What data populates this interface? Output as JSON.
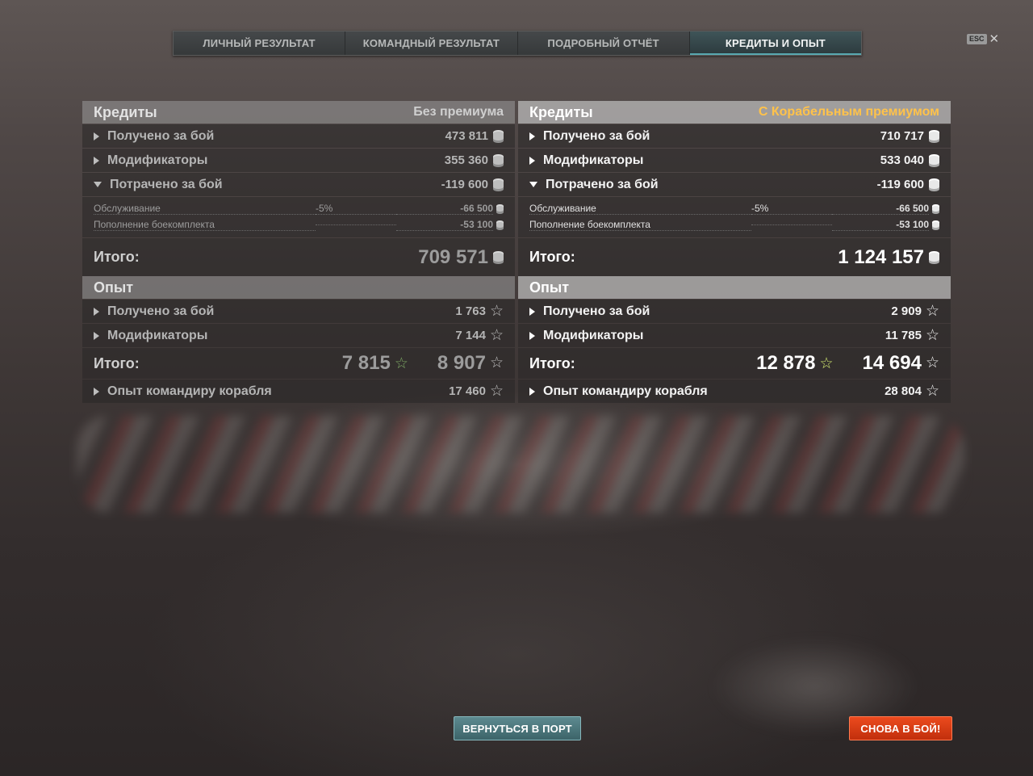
{
  "tabs": [
    {
      "label": "ЛИЧНЫЙ РЕЗУЛЬТАТ",
      "active": false
    },
    {
      "label": "КОМАНДНЫЙ РЕЗУЛЬТАТ",
      "active": false
    },
    {
      "label": "ПОДРОБНЫЙ ОТЧЁТ",
      "active": false
    },
    {
      "label": "КРЕДИТЫ И ОПЫТ",
      "active": true
    }
  ],
  "esc": {
    "key": "ESC",
    "close": "✕"
  },
  "colors": {
    "premium_accent": "#ffc24a",
    "xp_green": "#a8e86a",
    "battle_button": "#e0401a",
    "port_button": "#4d767b"
  },
  "left": {
    "credits": {
      "title": "Кредиты",
      "subtitle": "Без премиума",
      "earned": {
        "label": "Получено за бой",
        "value": "473 811"
      },
      "modifiers": {
        "label": "Модификаторы",
        "value": "355 360"
      },
      "spent": {
        "label": "Потрачено за бой",
        "value": "-119 600"
      },
      "service": {
        "label": "Обслуживание",
        "pct": "-5%",
        "value": "-66 500"
      },
      "ammo": {
        "label": "Пополнение боекомплекта",
        "value": "-53 100"
      },
      "total": {
        "label": "Итого:",
        "value": "709 571"
      }
    },
    "xp": {
      "title": "Опыт",
      "earned": {
        "label": "Получено за бой",
        "value": "1 763"
      },
      "modifiers": {
        "label": "Модификаторы",
        "value": "7 144"
      },
      "total": {
        "label": "Итого:",
        "free_value": "7 815",
        "value": "8 907"
      },
      "commander": {
        "label": "Опыт командиру корабля",
        "value": "17 460"
      }
    }
  },
  "right": {
    "credits": {
      "title": "Кредиты",
      "subtitle": "С Корабельным премиумом",
      "earned": {
        "label": "Получено за бой",
        "value": "710 717"
      },
      "modifiers": {
        "label": "Модификаторы",
        "value": "533 040"
      },
      "spent": {
        "label": "Потрачено за бой",
        "value": "-119 600"
      },
      "service": {
        "label": "Обслуживание",
        "pct": "-5%",
        "value": "-66 500"
      },
      "ammo": {
        "label": "Пополнение боекомплекта",
        "value": "-53 100"
      },
      "total": {
        "label": "Итого:",
        "value": "1 124 157"
      }
    },
    "xp": {
      "title": "Опыт",
      "earned": {
        "label": "Получено за бой",
        "value": "2 909"
      },
      "modifiers": {
        "label": "Модификаторы",
        "value": "11 785"
      },
      "total": {
        "label": "Итого:",
        "free_value": "12 878",
        "value": "14 694"
      },
      "commander": {
        "label": "Опыт командиру корабля",
        "value": "28 804"
      }
    }
  },
  "buttons": {
    "port": "ВЕРНУТЬСЯ В ПОРТ",
    "battle": "СНОВА В БОЙ!"
  },
  "icons": {
    "credit": "coin-stack-icon",
    "xp": "star-icon",
    "expand": "triangle-right-icon",
    "collapse": "triangle-down-icon"
  }
}
